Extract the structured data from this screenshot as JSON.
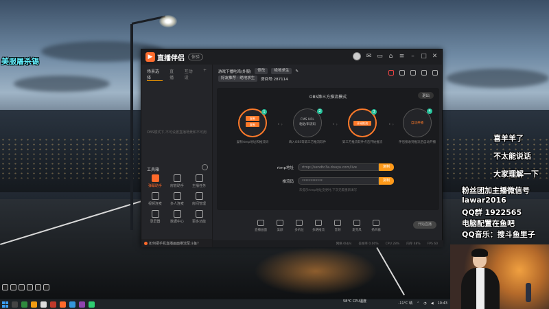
{
  "overlay": {
    "top_left": "美服屠杀锡",
    "lines_right": [
      "喜羊羊了",
      "不太能说话",
      "大家理解一下"
    ],
    "info": [
      "粉丝团加主播微信号",
      "lawar2016",
      "QQ群 1922565",
      "电脑配置在鱼吧",
      "QQ音乐：搜斗鱼里子"
    ]
  },
  "app": {
    "name": "直播伴侣",
    "version_badge": "体验",
    "left_tabs": [
      "场景选择",
      "直播",
      "互动设"
    ],
    "left_empty_text": "OBS模式下,不可设置直播场景和不可用",
    "tools_title": "工具箱",
    "tools": [
      {
        "label": "弹幕助手",
        "active": true
      },
      {
        "label": "房管助手",
        "active": false
      },
      {
        "label": "主播任务",
        "active": false
      },
      {
        "label": "视频连麦",
        "active": false
      },
      {
        "label": "多人连麦",
        "active": false
      },
      {
        "label": "房间管理",
        "active": false
      },
      {
        "label": "录屏器",
        "active": false
      },
      {
        "label": "数据中心",
        "active": false
      },
      {
        "label": "更多功能",
        "active": false
      }
    ],
    "left_footer": "如何把手机直播画面推流至斗鱼?",
    "header": {
      "room_title": "游戏下播吃鸡(外服)",
      "edit_label": "修改",
      "category": "绝地求生",
      "row2_a": "好友推荐 · 绝地求生",
      "row2_b": "房间号:287114"
    },
    "obs": {
      "title": "OBS第三方推流模式",
      "exit": "退出",
      "steps": [
        {
          "num": "1",
          "btns": [
            "复制",
            "复制"
          ],
          "desc": "复制rtmp地址和推流码"
        },
        {
          "num": "2",
          "lines": [
            "FMS URL",
            "粘贴/串流码"
          ],
          "desc": "填入OBS等第三方推流软件"
        },
        {
          "num": "3",
          "btns": [
            "开始推流"
          ],
          "desc": "第三方推流软件点击开始推流"
        },
        {
          "num": "4",
          "lines": [
            "自动开播"
          ],
          "desc": "伴侣接收到推流后自动开播"
        }
      ],
      "rtmp_label": "rtmp地址",
      "rtmp_value": "rtmp://sendtc3a.douyu.com/live",
      "key_label": "推流码",
      "key_value": "************",
      "copy_label": "复制",
      "hint": "未提示rtmp地址变更时,下次无需重新填写"
    },
    "toolbar": [
      "直播画面",
      "美颜",
      "多机位",
      "多路推流",
      "音频",
      "麦克风",
      "扬声器"
    ],
    "start_label": "开始直播",
    "status": [
      "网络 0kb/s",
      "丢帧率 0.00%",
      "CPU 28%",
      "内存 48%",
      "FPS 60"
    ]
  },
  "taskbar": {
    "weather": "-11°C 晴",
    "cpu": "58°C CPU温度",
    "time": "10:43"
  },
  "colors": {
    "accent": "#ff7a2a",
    "copy": "#ff9a1a",
    "step_num": "#27c29c"
  }
}
